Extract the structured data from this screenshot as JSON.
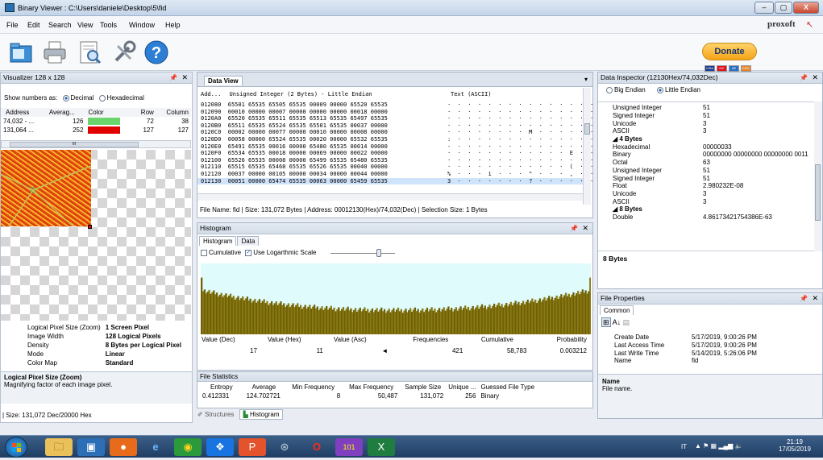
{
  "window": {
    "title": "Binary Viewer : C:\\Users\\daniele\\Desktop\\5\\fid",
    "min": "–",
    "max": "▢",
    "close": "X"
  },
  "menu": [
    "File",
    "Edit",
    "Search",
    "View",
    "Tools",
    "Window",
    "Help"
  ],
  "brand": {
    "logo": "proxoft"
  },
  "donate": {
    "label": "Donate",
    "cards": [
      "VISA",
      "MC",
      "AE",
      "DISC"
    ]
  },
  "colors": {
    "accent": "#2a6fb0",
    "green": "#6bd36b",
    "red": "#e00000",
    "taskbar": "#2c4a70"
  },
  "visualizer": {
    "title": "Visualizer 128 x 128",
    "show_numbers_label": "Show numbers as:",
    "decimal_label": "Decimal",
    "hex_label": "Hexadecimal",
    "columns": [
      "Address",
      "Averag...",
      "Color",
      "Row",
      "Column"
    ],
    "rows": [
      {
        "address": "74,032 - ...",
        "average": "126",
        "row": "72",
        "column": "38",
        "color": "#6bd36b"
      },
      {
        "address": "131,064 ...",
        "average": "252",
        "row": "127",
        "column": "127",
        "color": "#e00000"
      }
    ],
    "scroll_dots": "III",
    "props": [
      {
        "k": "Logical Pixel Size (Zoom)",
        "v": "1 Screen Pixel"
      },
      {
        "k": "Image Width",
        "v": "128 Logical Pixels"
      },
      {
        "k": "Density",
        "v": "8 Bytes per Logical Pixel"
      },
      {
        "k": "Mode",
        "v": "Linear"
      },
      {
        "k": "Color Map",
        "v": "Standard"
      }
    ],
    "desc_title": "Logical Pixel Size (Zoom)",
    "desc_text": "Magnifying factor of each image pixel.",
    "status": "| Size: 131,072 Dec/20000 Hex"
  },
  "dataview": {
    "tab": "Data View",
    "header_add": "Add...",
    "header_type": "Unsigned Integer (2 Bytes) - Little Endian",
    "header_text": "Text (ASCII)",
    "rows": [
      {
        "a": "012080",
        "v": "65501 65535 65505 65535 00009 00000 65520 65535",
        "t": "·  ·  ·  ·  ·  ·  ·  ·  ·  ·  ·  ·  ·  ·  ·  ·"
      },
      {
        "a": "012090",
        "v": "00010 00000 00007 00000 00000 00000 00018 00000",
        "t": "·  ·  ·  ·  ·  ·  ·  ·  ·  ·  ·  ·  ·  ·  ·  ·"
      },
      {
        "a": "0120A0",
        "v": "65520 65535 65511 65535 65513 65535 65497 65535",
        "t": "·  ·  ·  ·  ·  ·  ·  ·  ·  ·  ·  ·  ·  ·  ·  ·"
      },
      {
        "a": "0120B0",
        "v": "65511 65535 65524 65535 65501 65535 00037 00000",
        "t": "·  ·  ·  ·  ·  ·  ·  ·  ·  ·  ·  ·  ·  ·  ·  ·"
      },
      {
        "a": "0120C0",
        "v": "00002 00000 00077 00000 00010 00000 00008 00000",
        "t": "·  ·  ·  ·  ·  ·  ·  ·  M  ·  ·  ·  ·  ·  ·  ·"
      },
      {
        "a": "0120D0",
        "v": "00058 00000 65524 65535 00020 00000 65532 65535",
        "t": ":  ·  ·  ·  ·  ·  ·  ·  ·  ·  ·  ·  ·  ·  ·  ·"
      },
      {
        "a": "0120E0",
        "v": "65491 65535 00016 00000 65480 65535 00014 00000",
        "t": "·  ·  ·  ·  ·  ·  ·  ·  ·  ·  ·  ·  ·  ·  ·  ·"
      },
      {
        "a": "0120F0",
        "v": "65534 65535 00018 00000 00069 00000 00022 00000",
        "t": "·  ·  ·  ·  ·  ·  ·  ·  ·  ·  ·  ·  E  ·  ·  ·"
      },
      {
        "a": "012100",
        "v": "65526 65535 00008 00000 65499 65535 65480 65535",
        "t": "·  ·  ·  ·  ·  ·  ·  ·  ·  ·  ·  ·  ·  ·  ·  ·"
      },
      {
        "a": "012110",
        "v": "65515 65535 65468 65535 65526 65535 00040 00000",
        "t": "·  ·  ·  ·  ·  ·  ·  ·  ·  ·  ·  ·  (  ·  ·  ·"
      },
      {
        "a": "012120",
        "v": "00037 00000 00105 00000 00034 00000 00044 00000",
        "t": "%  ·  ·  ·  i  ·  ·  ·  \"  ·  ·  ·  ,  ·  ·  ·"
      },
      {
        "a": "012130",
        "v": "00051 00000 65474 65535 00063 00000 65459 65535",
        "t": "3  ·  ·  ·  ·  ·  ·  ·  ?  ·  ·  ·  ·  ·  ·  ·"
      }
    ],
    "status": "File Name: fid  |  Size: 131,072 Bytes  |  Address: 00012130(Hex)/74,032(Dec)  |  Selection Size: 1 Bytes"
  },
  "histogram": {
    "title": "Histogram",
    "tabs": [
      "Histogram",
      "Data"
    ],
    "cumulative_label": "Cumulative",
    "log_label": "Use Logarthmic Scale",
    "cols": [
      "Value (Dec)",
      "Value (Hex)",
      "Value (Asc)",
      "Frequencies",
      "Cumulative",
      "Probability"
    ],
    "row": {
      "dec": "17",
      "hex": "11",
      "asc": "◄",
      "freq": "421",
      "cum": "58,783",
      "prob": "0.003212"
    }
  },
  "stats": {
    "title": "File Statistics",
    "cols": [
      "Entropy",
      "Average",
      "Min Frequency",
      "Max Frequency",
      "Sample Size",
      "Unique ...",
      "Guessed File Type"
    ],
    "row": {
      "entropy": "0.412331",
      "average": "124.702721",
      "min": "8",
      "max": "50,487",
      "sample": "131,072",
      "unique": "256",
      "type": "Binary"
    }
  },
  "bottom_tabs": [
    "Structures",
    "Histogram"
  ],
  "inspector": {
    "title": "Data Inspector (12130Hex/74,032Dec)",
    "big_endian": "Big Endian",
    "little_endian": "Little Endian",
    "rows_top": [
      {
        "k": "Unsigned Integer",
        "v": "51"
      },
      {
        "k": "Signed Integer",
        "v": "51"
      },
      {
        "k": "Unicode",
        "v": "3"
      },
      {
        "k": "ASCII",
        "v": "3"
      }
    ],
    "group4": "4 Bytes",
    "rows4": [
      {
        "k": "Hexadecimal",
        "v": "00000033"
      },
      {
        "k": "Binary",
        "v": "00000000 00000000 00000000 0011"
      },
      {
        "k": "Octal",
        "v": "63"
      },
      {
        "k": "Unsigned Integer",
        "v": "51"
      },
      {
        "k": "Signed Integer",
        "v": "51"
      },
      {
        "k": "Float",
        "v": "2.980232E-08"
      },
      {
        "k": "Unicode",
        "v": "3"
      },
      {
        "k": "ASCII",
        "v": "3"
      }
    ],
    "group8": "8 Bytes",
    "rows8": [
      {
        "k": "Double",
        "v": "4.86173421754386E-63"
      }
    ],
    "desc": "8 Bytes"
  },
  "fileprops": {
    "title": "File Properties",
    "tab": "Common",
    "rows": [
      {
        "k": "Create Date",
        "v": "5/17/2019, 9:00:26 PM"
      },
      {
        "k": "Last Access Time",
        "v": "5/17/2019, 9:00:26 PM"
      },
      {
        "k": "Last Write Time",
        "v": "5/14/2019, 5:26:06 PM"
      },
      {
        "k": "Name",
        "v": "fid"
      }
    ],
    "desc_title": "Name",
    "desc_text": "File name."
  },
  "taskbar": {
    "lang": "IT",
    "time": "21:19",
    "date": "17/05/2019"
  }
}
